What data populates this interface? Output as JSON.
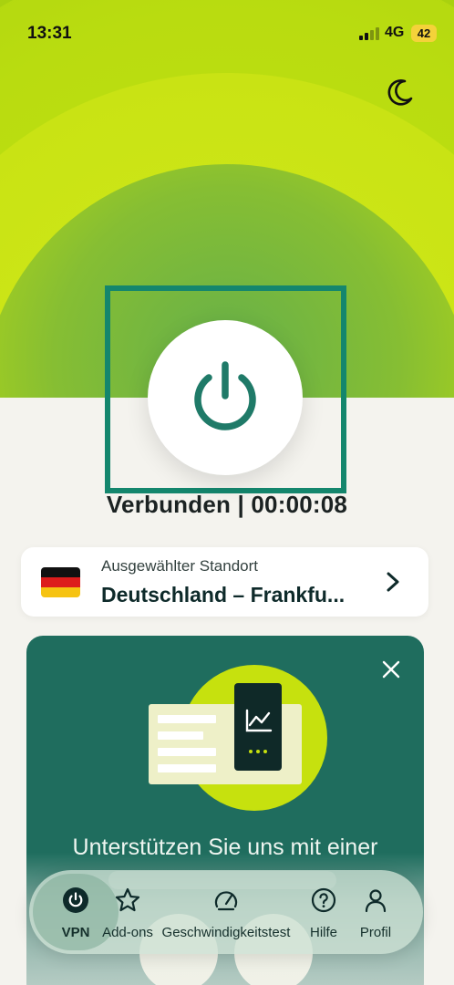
{
  "status_bar": {
    "time": "13:31",
    "network": "4G",
    "battery": "42"
  },
  "colors": {
    "brand_green": "#1f6d5e",
    "accent_lime": "#c6e10e",
    "highlight": "#14866d"
  },
  "connection": {
    "status": "Verbunden | 00:00:08"
  },
  "location": {
    "label": "Ausgewählter Standort",
    "value": "Deutschland – Frankfu...",
    "flag_icon": "germany-flag-icon"
  },
  "promo": {
    "title": "Unterstützen Sie uns mit einer"
  },
  "tabs": [
    {
      "label": "VPN",
      "icon": "power-icon",
      "active": true
    },
    {
      "label": "Add-ons",
      "icon": "star-icon",
      "active": false
    },
    {
      "label": "Geschwindigkeitstest",
      "icon": "speedometer-icon",
      "active": false
    },
    {
      "label": "Hilfe",
      "icon": "help-circle-icon",
      "active": false
    },
    {
      "label": "Profil",
      "icon": "person-icon",
      "active": false
    }
  ]
}
